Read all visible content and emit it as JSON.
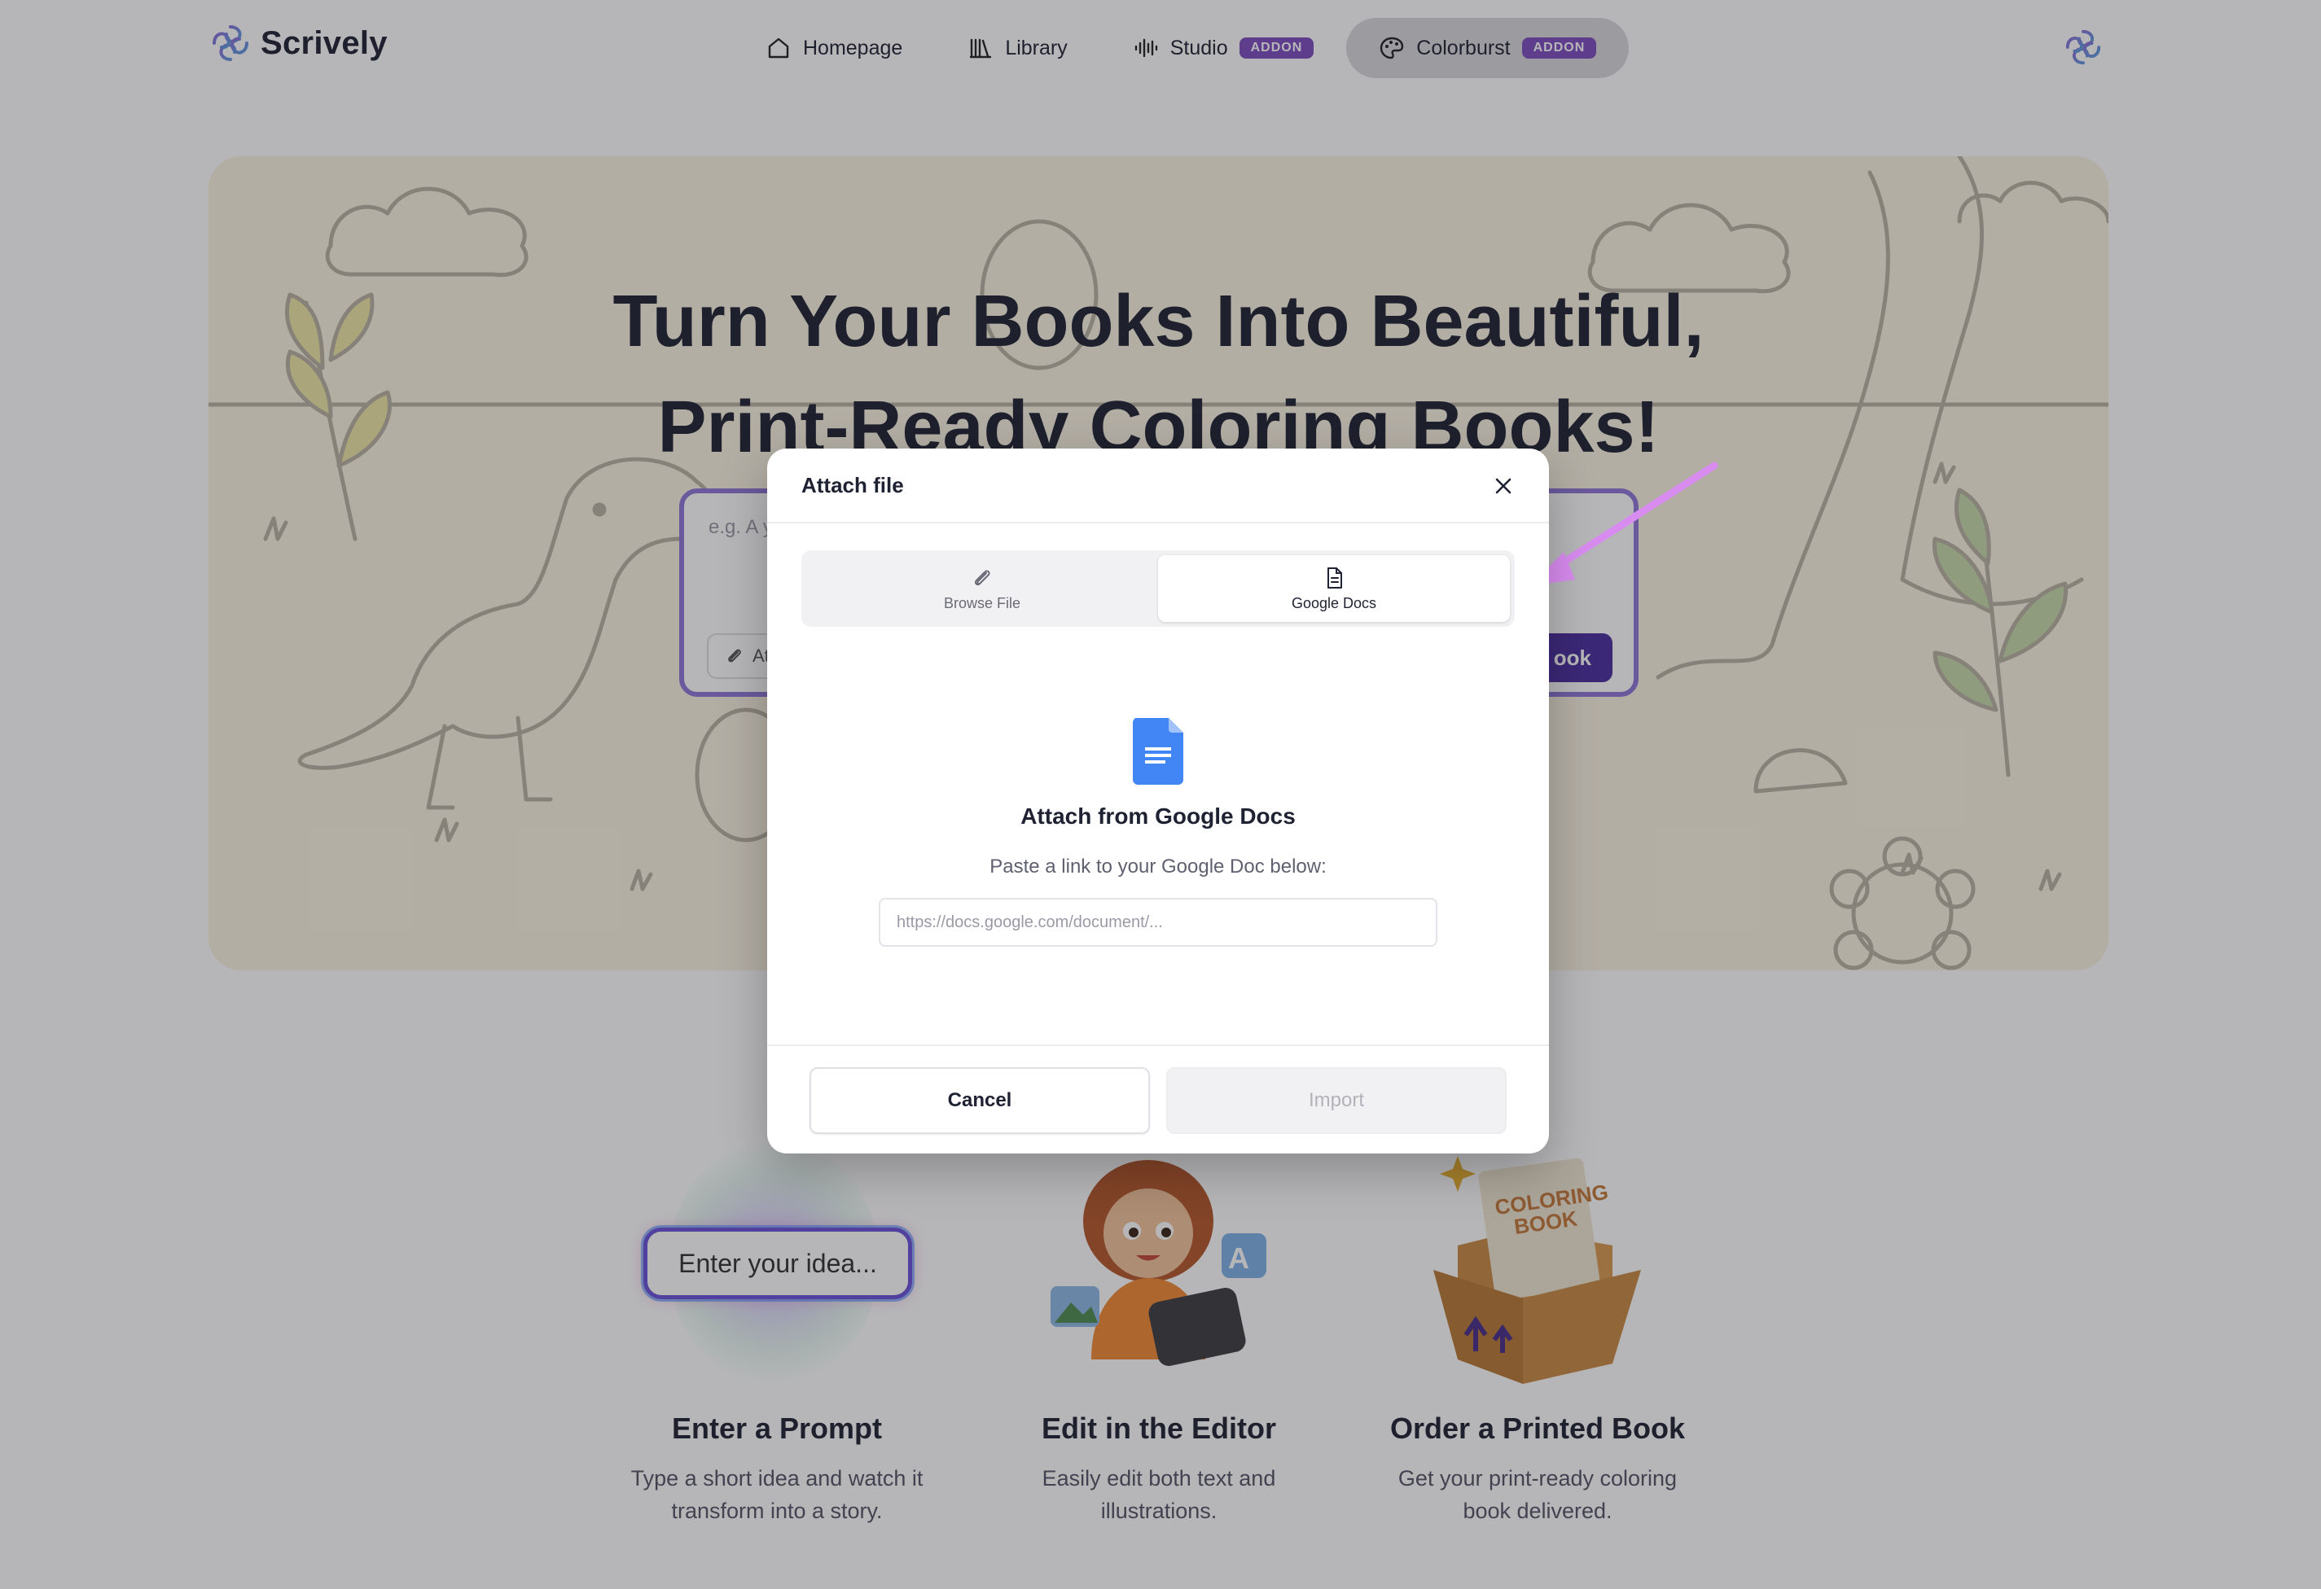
{
  "brand": {
    "name": "Scrively"
  },
  "nav": {
    "items": [
      {
        "label": "Homepage",
        "icon": "home-icon"
      },
      {
        "label": "Library",
        "icon": "library-icon"
      },
      {
        "label": "Studio",
        "icon": "audio-wave-icon",
        "badge": "ADDON"
      },
      {
        "label": "Colorburst",
        "icon": "palette-icon",
        "badge": "ADDON",
        "active": true
      }
    ]
  },
  "hero": {
    "title_line1": "Turn Your Books Into Beautiful,",
    "title_line2": "Print-Ready Coloring Books!",
    "input_placeholder_visible": "e.g. A y",
    "attach_label_visible": "At",
    "create_label_visible": "ook"
  },
  "steps": [
    {
      "title": "Enter a Prompt",
      "desc_line1": "Type a short idea and watch it",
      "desc_line2": "transform into a story.",
      "pill": "Enter your idea..."
    },
    {
      "title": "Edit in the Editor",
      "desc_line1": "Easily edit both text and",
      "desc_line2": "illustrations."
    },
    {
      "title": "Order a Printed Book",
      "desc_line1": "Get your print-ready coloring",
      "desc_line2": "book delivered.",
      "box_text_line1": "COLORING",
      "box_text_line2": "BOOK"
    }
  ],
  "modal": {
    "title": "Attach file",
    "tabs": [
      {
        "label": "Browse File",
        "icon": "paperclip-icon",
        "selected": false
      },
      {
        "label": "Google Docs",
        "icon": "document-icon",
        "selected": true
      }
    ],
    "heading": "Attach from Google Docs",
    "subtitle": "Paste a link to your Google Doc below:",
    "link_input": {
      "placeholder": "https://docs.google.com/document/...",
      "value": ""
    },
    "cancel_label": "Cancel",
    "import_label": "Import"
  },
  "colors": {
    "accent": "#7c4dbf",
    "primary_button": "#4b2fa0",
    "hero_background": "#fbf4e2",
    "google_docs_blue": "#4285f4",
    "annotation_arrow": "#d98cf0"
  }
}
